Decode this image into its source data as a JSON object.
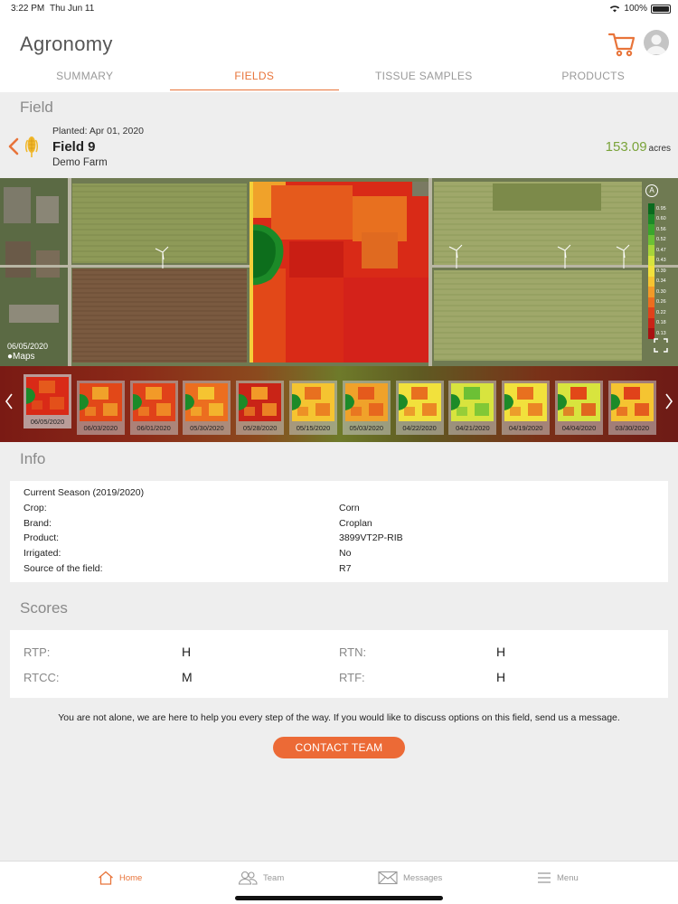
{
  "status": {
    "time": "3:22 PM",
    "date": "Thu Jun 11",
    "battery": "100%"
  },
  "header": {
    "title": "Agronomy",
    "cart_icon": "cart-icon",
    "avatar_icon": "user-avatar-icon"
  },
  "tabs": [
    {
      "label": "SUMMARY",
      "active": false
    },
    {
      "label": "FIELDS",
      "active": true
    },
    {
      "label": "TISSUE SAMPLES",
      "active": false
    },
    {
      "label": "PRODUCTS",
      "active": false
    }
  ],
  "field_section": {
    "title": "Field"
  },
  "field": {
    "planted_label": "Planted:",
    "planted_date": "Apr 01, 2020",
    "name": "Field 9",
    "farm": "Demo Farm",
    "acres_value": "153.09",
    "acres_unit": "acres"
  },
  "map": {
    "date": "06/05/2020",
    "attribution": "Maps",
    "legend_badge": "A",
    "legend": [
      {
        "value": "0.95",
        "color": "#0a6b1e"
      },
      {
        "value": "0.60",
        "color": "#1d8a28"
      },
      {
        "value": "0.56",
        "color": "#3aa52d"
      },
      {
        "value": "0.52",
        "color": "#6cc035"
      },
      {
        "value": "0.47",
        "color": "#a7d43a"
      },
      {
        "value": "0.43",
        "color": "#d8e43e"
      },
      {
        "value": "0.39",
        "color": "#f2e13c"
      },
      {
        "value": "0.34",
        "color": "#f5c431"
      },
      {
        "value": "0.30",
        "color": "#f29a28"
      },
      {
        "value": "0.26",
        "color": "#ec6e1f"
      },
      {
        "value": "0.22",
        "color": "#e0421a"
      },
      {
        "value": "0.18",
        "color": "#c92417"
      },
      {
        "value": "0.13",
        "color": "#a81212"
      }
    ]
  },
  "thumbnails": [
    "06/05/2020",
    "06/03/2020",
    "06/01/2020",
    "05/30/2020",
    "05/28/2020",
    "05/15/2020",
    "05/03/2020",
    "04/22/2020",
    "04/21/2020",
    "04/19/2020",
    "04/04/2020",
    "03/30/2020"
  ],
  "info_section": {
    "title": "Info"
  },
  "info": {
    "season": "Current Season (2019/2020)",
    "rows": [
      {
        "label": "Crop:",
        "value": "Corn"
      },
      {
        "label": "Brand:",
        "value": "Croplan"
      },
      {
        "label": "Product:",
        "value": "3899VT2P-RIB"
      },
      {
        "label": "Irrigated:",
        "value": "No"
      },
      {
        "label": "Source of the field:",
        "value": "R7"
      }
    ]
  },
  "scores_section": {
    "title": "Scores"
  },
  "scores": [
    {
      "label": "RTP:",
      "value": "H"
    },
    {
      "label": "RTN:",
      "value": "H"
    },
    {
      "label": "RTCC:",
      "value": "M"
    },
    {
      "label": "RTF:",
      "value": "H"
    }
  ],
  "help": {
    "text": "You are not alone, we are here to help you every step of the way. If you would like to discuss options on this field, send us a message.",
    "button": "CONTACT TEAM"
  },
  "bottom_nav": [
    {
      "label": "Home",
      "icon": "home-icon",
      "active": true
    },
    {
      "label": "Team",
      "icon": "team-icon",
      "active": false
    },
    {
      "label": "Messages",
      "icon": "envelope-icon",
      "active": false
    },
    {
      "label": "Menu",
      "icon": "hamburger-icon",
      "active": false
    }
  ]
}
